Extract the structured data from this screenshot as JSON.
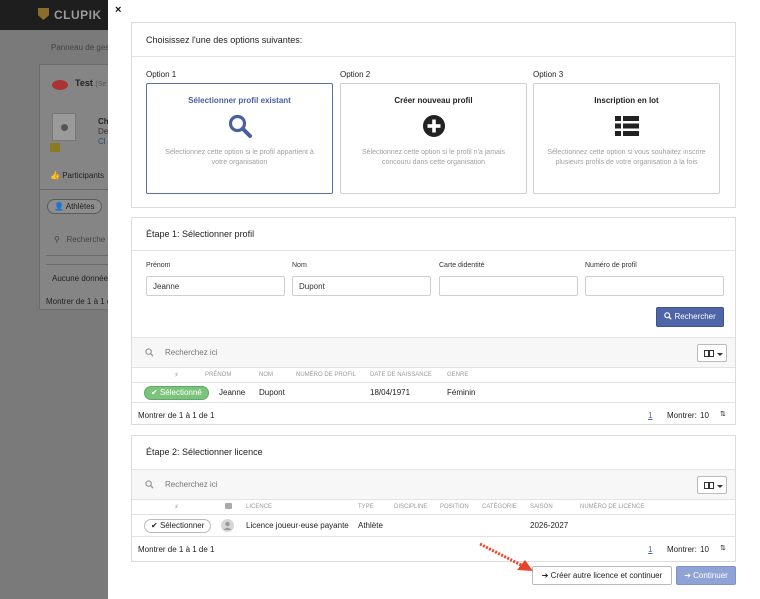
{
  "background": {
    "brand": "CLUPIK",
    "breadcrumb": "Panneau de ges",
    "card_title": "Test",
    "card_title_sub": "(Se",
    "org_line1": "Ch",
    "org_line2": "De",
    "org_line3": "Cl",
    "tab_label": "Participants",
    "filter_label": "Athlètes",
    "search_placeholder": "Recherche",
    "no_data": "Aucune donnée",
    "showing": "Montrer de 1 à 1 d"
  },
  "modal": {
    "close_symbol": "×",
    "options_panel": {
      "title": "Choisissez l'une des options suivantes:",
      "options": [
        {
          "label": "Option 1",
          "title": "Sélectionner profil existant",
          "description": "Sélectionnez cette option si le profil appartient à votre organisation",
          "icon": "search-icon",
          "selected": true
        },
        {
          "label": "Option 2",
          "title": "Créer nouveau profil",
          "description": "Sélectionnez cette option si le profil n'a jamais concouru dans cette organisation",
          "icon": "plus-circle-icon",
          "selected": false
        },
        {
          "label": "Option 3",
          "title": "Inscription en lot",
          "description": "Sélectionnez cette option si vous souhaitez inscrire plusieurs profils de votre organisation à la fois",
          "icon": "list-icon",
          "selected": false
        }
      ]
    },
    "step1": {
      "title": "Étape 1: Sélectionner profil",
      "fields": {
        "prenom": {
          "label": "Prénom",
          "value": "Jeanne"
        },
        "nom": {
          "label": "Nom",
          "value": "Dupont"
        },
        "carte": {
          "label": "Carte didentité",
          "value": ""
        },
        "numero": {
          "label": "Numéro de profil",
          "value": ""
        }
      },
      "search_button": "Rechercher",
      "table": {
        "search_placeholder": "Recherchez ici",
        "columns": [
          "",
          "Prénom",
          "Nom",
          "Numéro de profil",
          "Date de naissance",
          "Genre"
        ],
        "rows": [
          {
            "action": "Sélectionné",
            "prenom": "Jeanne",
            "nom": "Dupont",
            "numero": "",
            "naissance": "18/04/1971",
            "genre": "Féminin"
          }
        ],
        "footer": {
          "showing": "Montrer de 1 à 1 de 1",
          "page": "1",
          "show_label": "Montrer:",
          "page_size": "10"
        }
      }
    },
    "step2": {
      "title": "Étape 2: Sélectionner licence",
      "table": {
        "search_placeholder": "Recherchez ici",
        "columns": [
          "",
          "",
          "Licence",
          "Type",
          "Discipline",
          "Position",
          "Catégorie",
          "Saison",
          "Numéro de licence"
        ],
        "rows": [
          {
            "action": "Sélectionner",
            "licence": "Licence joueur·euse payante",
            "type": "Athlète",
            "discipline": "",
            "position": "",
            "categorie": "",
            "saison": "2026-2027",
            "numero": ""
          }
        ],
        "footer": {
          "showing": "Montrer de 1 à 1 de 1",
          "page": "1",
          "show_label": "Montrer:",
          "page_size": "10"
        }
      }
    },
    "footer_buttons": {
      "other": "Créer autre licence et continuer",
      "continue": "Continuer"
    }
  },
  "colors": {
    "primary": "#4e65a8",
    "selected_green": "#7cc47e",
    "continue_disabled": "#8fa3d6",
    "annotation_arrow": "#e8452c"
  }
}
